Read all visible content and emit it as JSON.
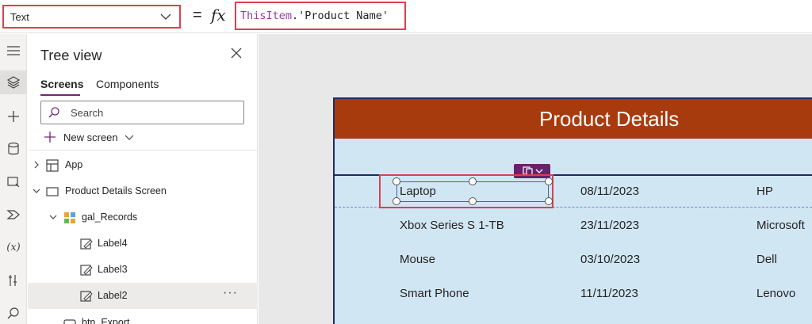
{
  "formula_bar": {
    "property": "Text",
    "equals": "=",
    "fx": "fx",
    "formula_keyword": "ThisItem",
    "formula_rest": ".'Product Name'"
  },
  "tree_view": {
    "title": "Tree view",
    "tabs": [
      "Screens",
      "Components"
    ],
    "active_tab": "Screens",
    "search_placeholder": "Search",
    "new_screen_label": "New screen",
    "nodes": [
      {
        "label": "App",
        "icon": "app-icon"
      },
      {
        "label": "Product Details Screen",
        "icon": "screen-icon"
      },
      {
        "label": "gal_Records",
        "icon": "gallery-icon"
      },
      {
        "label": "Label4",
        "icon": "label-edit-icon"
      },
      {
        "label": "Label3",
        "icon": "label-edit-icon"
      },
      {
        "label": "Label2",
        "icon": "label-edit-icon",
        "selected": true,
        "more": "···"
      },
      {
        "label": "btn_Export",
        "icon": "button-icon"
      }
    ]
  },
  "app_screen": {
    "title": "Product Details",
    "rows": [
      {
        "name": "Laptop",
        "date": "08/11/2023",
        "brand": "HP"
      },
      {
        "name": "Xbox Series S 1-TB",
        "date": "23/11/2023",
        "brand": "Microsoft"
      },
      {
        "name": "Mouse",
        "date": "03/10/2023",
        "brand": "Dell"
      },
      {
        "name": "Smart Phone",
        "date": "11/11/2023",
        "brand": "Lenovo"
      }
    ]
  },
  "colors": {
    "accent_highlight": "#d9414e",
    "header_band": "#a83b0e",
    "gallery_bg": "#d1e6f3",
    "formula_keyword": "#9d3b9d",
    "label_tools": "#6b2167"
  }
}
